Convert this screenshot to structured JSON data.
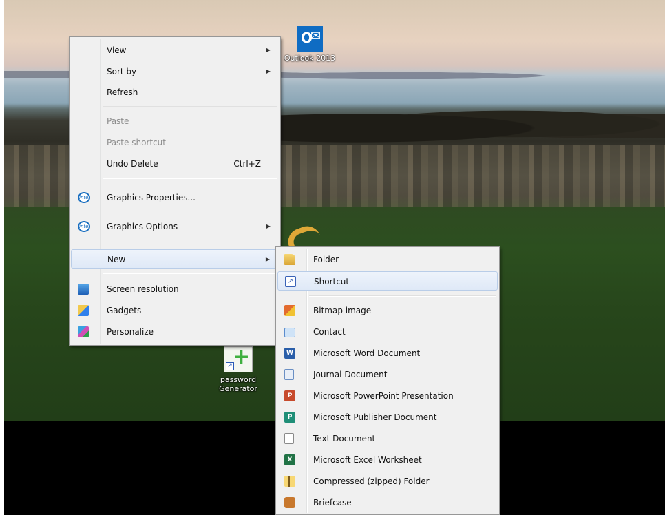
{
  "desktop": {
    "icons": [
      {
        "label": "Outlook 2013",
        "icon": "outlook-icon"
      },
      {
        "label_line1": "password",
        "label_line2": "Generator",
        "icon": "password-generator-icon"
      }
    ]
  },
  "context_menu": {
    "items": [
      {
        "label": "View",
        "submenu": true
      },
      {
        "label": "Sort by",
        "submenu": true
      },
      {
        "label": "Refresh"
      },
      {
        "label": "Paste",
        "disabled": true
      },
      {
        "label": "Paste shortcut",
        "disabled": true
      },
      {
        "label": "Undo Delete",
        "shortcut": "Ctrl+Z"
      },
      {
        "label": "Graphics Properties...",
        "icon": "intel-icon"
      },
      {
        "label": "Graphics Options",
        "icon": "intel-icon",
        "submenu": true
      },
      {
        "label": "New",
        "submenu": true,
        "highlighted": true
      },
      {
        "label": "Screen resolution",
        "icon": "screen-resolution-icon"
      },
      {
        "label": "Gadgets",
        "icon": "gadgets-icon"
      },
      {
        "label": "Personalize",
        "icon": "personalize-icon"
      }
    ],
    "intel_glyph": "intel",
    "arrow_glyph": "▶"
  },
  "new_submenu": {
    "items": [
      {
        "label": "Folder",
        "icon": "folder-icon"
      },
      {
        "label": "Shortcut",
        "icon": "shortcut-icon",
        "highlighted": true
      },
      {
        "label": "Bitmap image",
        "icon": "bitmap-icon"
      },
      {
        "label": "Contact",
        "icon": "contact-icon"
      },
      {
        "label": "Microsoft Word Document",
        "icon": "word-icon"
      },
      {
        "label": "Journal Document",
        "icon": "journal-icon"
      },
      {
        "label": "Microsoft PowerPoint Presentation",
        "icon": "powerpoint-icon"
      },
      {
        "label": "Microsoft Publisher Document",
        "icon": "publisher-icon"
      },
      {
        "label": "Text Document",
        "icon": "text-document-icon"
      },
      {
        "label": "Microsoft Excel Worksheet",
        "icon": "excel-icon"
      },
      {
        "label": "Compressed (zipped) Folder",
        "icon": "zip-folder-icon"
      },
      {
        "label": "Briefcase",
        "icon": "briefcase-icon"
      }
    ],
    "glyphs": {
      "shortcut": "↗",
      "word": "W",
      "powerpoint": "P",
      "publisher": "P",
      "excel": "X"
    }
  },
  "colors": {
    "menu_bg": "#f0f0f0",
    "highlight_border": "#b9cde8",
    "disabled_text": "#8d8d8d"
  }
}
